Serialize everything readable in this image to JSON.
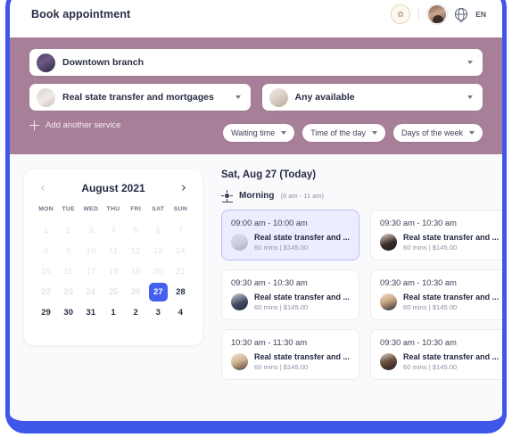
{
  "topbar": {
    "title": "Book appointment",
    "brand_badge_icon": "brand-logo-icon",
    "avatar_icon": "user-avatar",
    "globe_icon": "globe-icon",
    "language": "EN"
  },
  "filters_panel": {
    "branch_select": {
      "label": "Downtown branch",
      "thumb": "branch-photo"
    },
    "service_select": {
      "label": "Real state transfer and mortgages",
      "thumb": "service-photo"
    },
    "staff_select": {
      "label": "Any available",
      "thumb": "staff-photo"
    },
    "add_service": {
      "label": "Add another service",
      "icon": "plus-icon"
    },
    "chips": [
      {
        "label": "Waiting time"
      },
      {
        "label": "Time of the day"
      },
      {
        "label": "Days of the week"
      }
    ],
    "background_color": "#a87f99"
  },
  "calendar": {
    "title": "August 2021",
    "prev_icon": "chevron-left-icon",
    "next_icon": "chevron-right-icon",
    "weekdays": [
      "MON",
      "TUE",
      "WED",
      "THU",
      "FRI",
      "SAT",
      "SUN"
    ],
    "selected_day": "27",
    "selected_color": "#4460ee",
    "days": [
      {
        "n": "1",
        "state": "disabled"
      },
      {
        "n": "2",
        "state": "disabled"
      },
      {
        "n": "3",
        "state": "disabled"
      },
      {
        "n": "4",
        "state": "disabled"
      },
      {
        "n": "5",
        "state": "disabled"
      },
      {
        "n": "6",
        "state": "disabled"
      },
      {
        "n": "7",
        "state": "disabled"
      },
      {
        "n": "8",
        "state": "disabled"
      },
      {
        "n": "9",
        "state": "disabled"
      },
      {
        "n": "10",
        "state": "disabled"
      },
      {
        "n": "11",
        "state": "disabled"
      },
      {
        "n": "12",
        "state": "disabled"
      },
      {
        "n": "13",
        "state": "disabled"
      },
      {
        "n": "14",
        "state": "disabled"
      },
      {
        "n": "15",
        "state": "disabled"
      },
      {
        "n": "16",
        "state": "disabled"
      },
      {
        "n": "17",
        "state": "disabled"
      },
      {
        "n": "18",
        "state": "disabled"
      },
      {
        "n": "19",
        "state": "disabled"
      },
      {
        "n": "20",
        "state": "disabled"
      },
      {
        "n": "21",
        "state": "disabled"
      },
      {
        "n": "22",
        "state": "disabled"
      },
      {
        "n": "23",
        "state": "disabled"
      },
      {
        "n": "24",
        "state": "disabled"
      },
      {
        "n": "25",
        "state": "disabled"
      },
      {
        "n": "26",
        "state": "disabled"
      },
      {
        "n": "27",
        "state": "selected"
      },
      {
        "n": "28",
        "state": "available"
      },
      {
        "n": "29",
        "state": "available"
      },
      {
        "n": "30",
        "state": "available"
      },
      {
        "n": "31",
        "state": "available"
      },
      {
        "n": "1",
        "state": "available"
      },
      {
        "n": "2",
        "state": "available"
      },
      {
        "n": "3",
        "state": "available"
      },
      {
        "n": "4",
        "state": "available"
      }
    ]
  },
  "slots_panel": {
    "date_heading": "Sat, Aug 27 (Today)",
    "period": {
      "icon": "sun-icon",
      "label": "Morning",
      "range": "(9 am - 11 am)"
    },
    "slots": [
      {
        "time": "09:00 am - 10:00 am",
        "service": "Real state transfer and ...",
        "meta": "60 mins | $145.00",
        "avatar": "av-a",
        "selected": true
      },
      {
        "time": "09:30 am - 10:30 am",
        "service": "Real state transfer and ...",
        "meta": "60 mins | $145.00",
        "avatar": "av-b",
        "selected": false
      },
      {
        "time": "09:30 am - 10:30 am",
        "service": "Real state transfer and ...",
        "meta": "60 mins | $145.00",
        "avatar": "av-c",
        "selected": false
      },
      {
        "time": "09:30 am - 10:30 am",
        "service": "Real state transfer and ...",
        "meta": "60 mins | $145.00",
        "avatar": "av-d",
        "selected": false
      },
      {
        "time": "10:30 am - 11:30 am",
        "service": "Real state transfer and ...",
        "meta": "60 mins | $145.00",
        "avatar": "av-e",
        "selected": false
      },
      {
        "time": "09:30 am - 10:30 am",
        "service": "Real state transfer and ...",
        "meta": "60 mins | $145.00",
        "avatar": "av-f",
        "selected": false
      }
    ]
  }
}
